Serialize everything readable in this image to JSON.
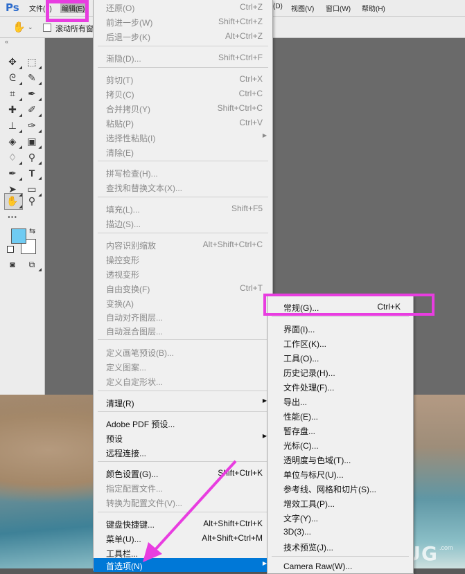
{
  "app": {
    "logo": "Ps"
  },
  "menubar": {
    "items": [
      "文件(F)",
      "编辑(E)",
      "(D)",
      "视图(V)",
      "窗口(W)",
      "帮助(H)"
    ]
  },
  "options_bar": {
    "scroll_all_label": "滚动所有窗"
  },
  "edit_menu": {
    "items": [
      {
        "label": "还原(O)",
        "shortcut": "Ctrl+Z",
        "enabled": false
      },
      {
        "label": "前进一步(W)",
        "shortcut": "Shift+Ctrl+Z",
        "enabled": false
      },
      {
        "label": "后退一步(K)",
        "shortcut": "Alt+Ctrl+Z",
        "enabled": false
      },
      {
        "label": "渐隐(D)...",
        "shortcut": "Shift+Ctrl+F",
        "enabled": false
      },
      {
        "label": "剪切(T)",
        "shortcut": "Ctrl+X",
        "enabled": false
      },
      {
        "label": "拷贝(C)",
        "shortcut": "Ctrl+C",
        "enabled": false
      },
      {
        "label": "合并拷贝(Y)",
        "shortcut": "Shift+Ctrl+C",
        "enabled": false
      },
      {
        "label": "粘贴(P)",
        "shortcut": "Ctrl+V",
        "enabled": false
      },
      {
        "label": "选择性粘贴(I)",
        "shortcut": "",
        "enabled": false
      },
      {
        "label": "清除(E)",
        "shortcut": "",
        "enabled": false
      },
      {
        "label": "拼写检查(H)...",
        "shortcut": "",
        "enabled": false
      },
      {
        "label": "查找和替换文本(X)...",
        "shortcut": "",
        "enabled": false
      },
      {
        "label": "填充(L)...",
        "shortcut": "Shift+F5",
        "enabled": false
      },
      {
        "label": "描边(S)...",
        "shortcut": "",
        "enabled": false
      },
      {
        "label": "内容识别缩放",
        "shortcut": "Alt+Shift+Ctrl+C",
        "enabled": false
      },
      {
        "label": "操控变形",
        "shortcut": "",
        "enabled": false
      },
      {
        "label": "透视变形",
        "shortcut": "",
        "enabled": false
      },
      {
        "label": "自由变换(F)",
        "shortcut": "Ctrl+T",
        "enabled": false
      },
      {
        "label": "变换(A)",
        "shortcut": "",
        "enabled": false
      },
      {
        "label": "自动对齐图层...",
        "shortcut": "",
        "enabled": false
      },
      {
        "label": "自动混合图层...",
        "shortcut": "",
        "enabled": false
      },
      {
        "label": "定义画笔预设(B)...",
        "shortcut": "",
        "enabled": false
      },
      {
        "label": "定义图案...",
        "shortcut": "",
        "enabled": false
      },
      {
        "label": "定义自定形状...",
        "shortcut": "",
        "enabled": false
      },
      {
        "label": "清理(R)",
        "shortcut": "",
        "enabled": true
      },
      {
        "label": "Adobe PDF 预设...",
        "shortcut": "",
        "enabled": true
      },
      {
        "label": "预设",
        "shortcut": "",
        "enabled": true
      },
      {
        "label": "远程连接...",
        "shortcut": "",
        "enabled": true
      },
      {
        "label": "颜色设置(G)...",
        "shortcut": "Shift+Ctrl+K",
        "enabled": true
      },
      {
        "label": "指定配置文件...",
        "shortcut": "",
        "enabled": false
      },
      {
        "label": "转换为配置文件(V)...",
        "shortcut": "",
        "enabled": false
      },
      {
        "label": "键盘快捷键...",
        "shortcut": "Alt+Shift+Ctrl+K",
        "enabled": true
      },
      {
        "label": "菜单(U)...",
        "shortcut": "Alt+Shift+Ctrl+M",
        "enabled": true
      },
      {
        "label": "工具栏...",
        "shortcut": "",
        "enabled": true
      },
      {
        "label": "首选项(N)",
        "shortcut": "",
        "enabled": true
      }
    ]
  },
  "preferences_menu": {
    "items": [
      {
        "label": "常规(G)...",
        "shortcut": "Ctrl+K"
      },
      {
        "label": "界面(I)...",
        "shortcut": ""
      },
      {
        "label": "工作区(K)...",
        "shortcut": ""
      },
      {
        "label": "工具(O)...",
        "shortcut": ""
      },
      {
        "label": "历史记录(H)...",
        "shortcut": ""
      },
      {
        "label": "文件处理(F)...",
        "shortcut": ""
      },
      {
        "label": "导出...",
        "shortcut": ""
      },
      {
        "label": "性能(E)...",
        "shortcut": ""
      },
      {
        "label": "暂存盘...",
        "shortcut": ""
      },
      {
        "label": "光标(C)...",
        "shortcut": ""
      },
      {
        "label": "透明度与色域(T)...",
        "shortcut": ""
      },
      {
        "label": "单位与标尺(U)...",
        "shortcut": ""
      },
      {
        "label": "参考线、网格和切片(S)...",
        "shortcut": ""
      },
      {
        "label": "增效工具(P)...",
        "shortcut": ""
      },
      {
        "label": "文字(Y)...",
        "shortcut": ""
      },
      {
        "label": "3D(3)...",
        "shortcut": ""
      },
      {
        "label": "技术预览(J)...",
        "shortcut": ""
      },
      {
        "label": "Camera Raw(W)...",
        "shortcut": ""
      }
    ]
  },
  "watermark": {
    "text": "UEBUG",
    "sub": ".com"
  },
  "colors": {
    "accent": "#0078d7",
    "annotation": "#e83de0",
    "foreground_swatch": "#6fcbf2",
    "background_swatch": "#ffffff"
  }
}
